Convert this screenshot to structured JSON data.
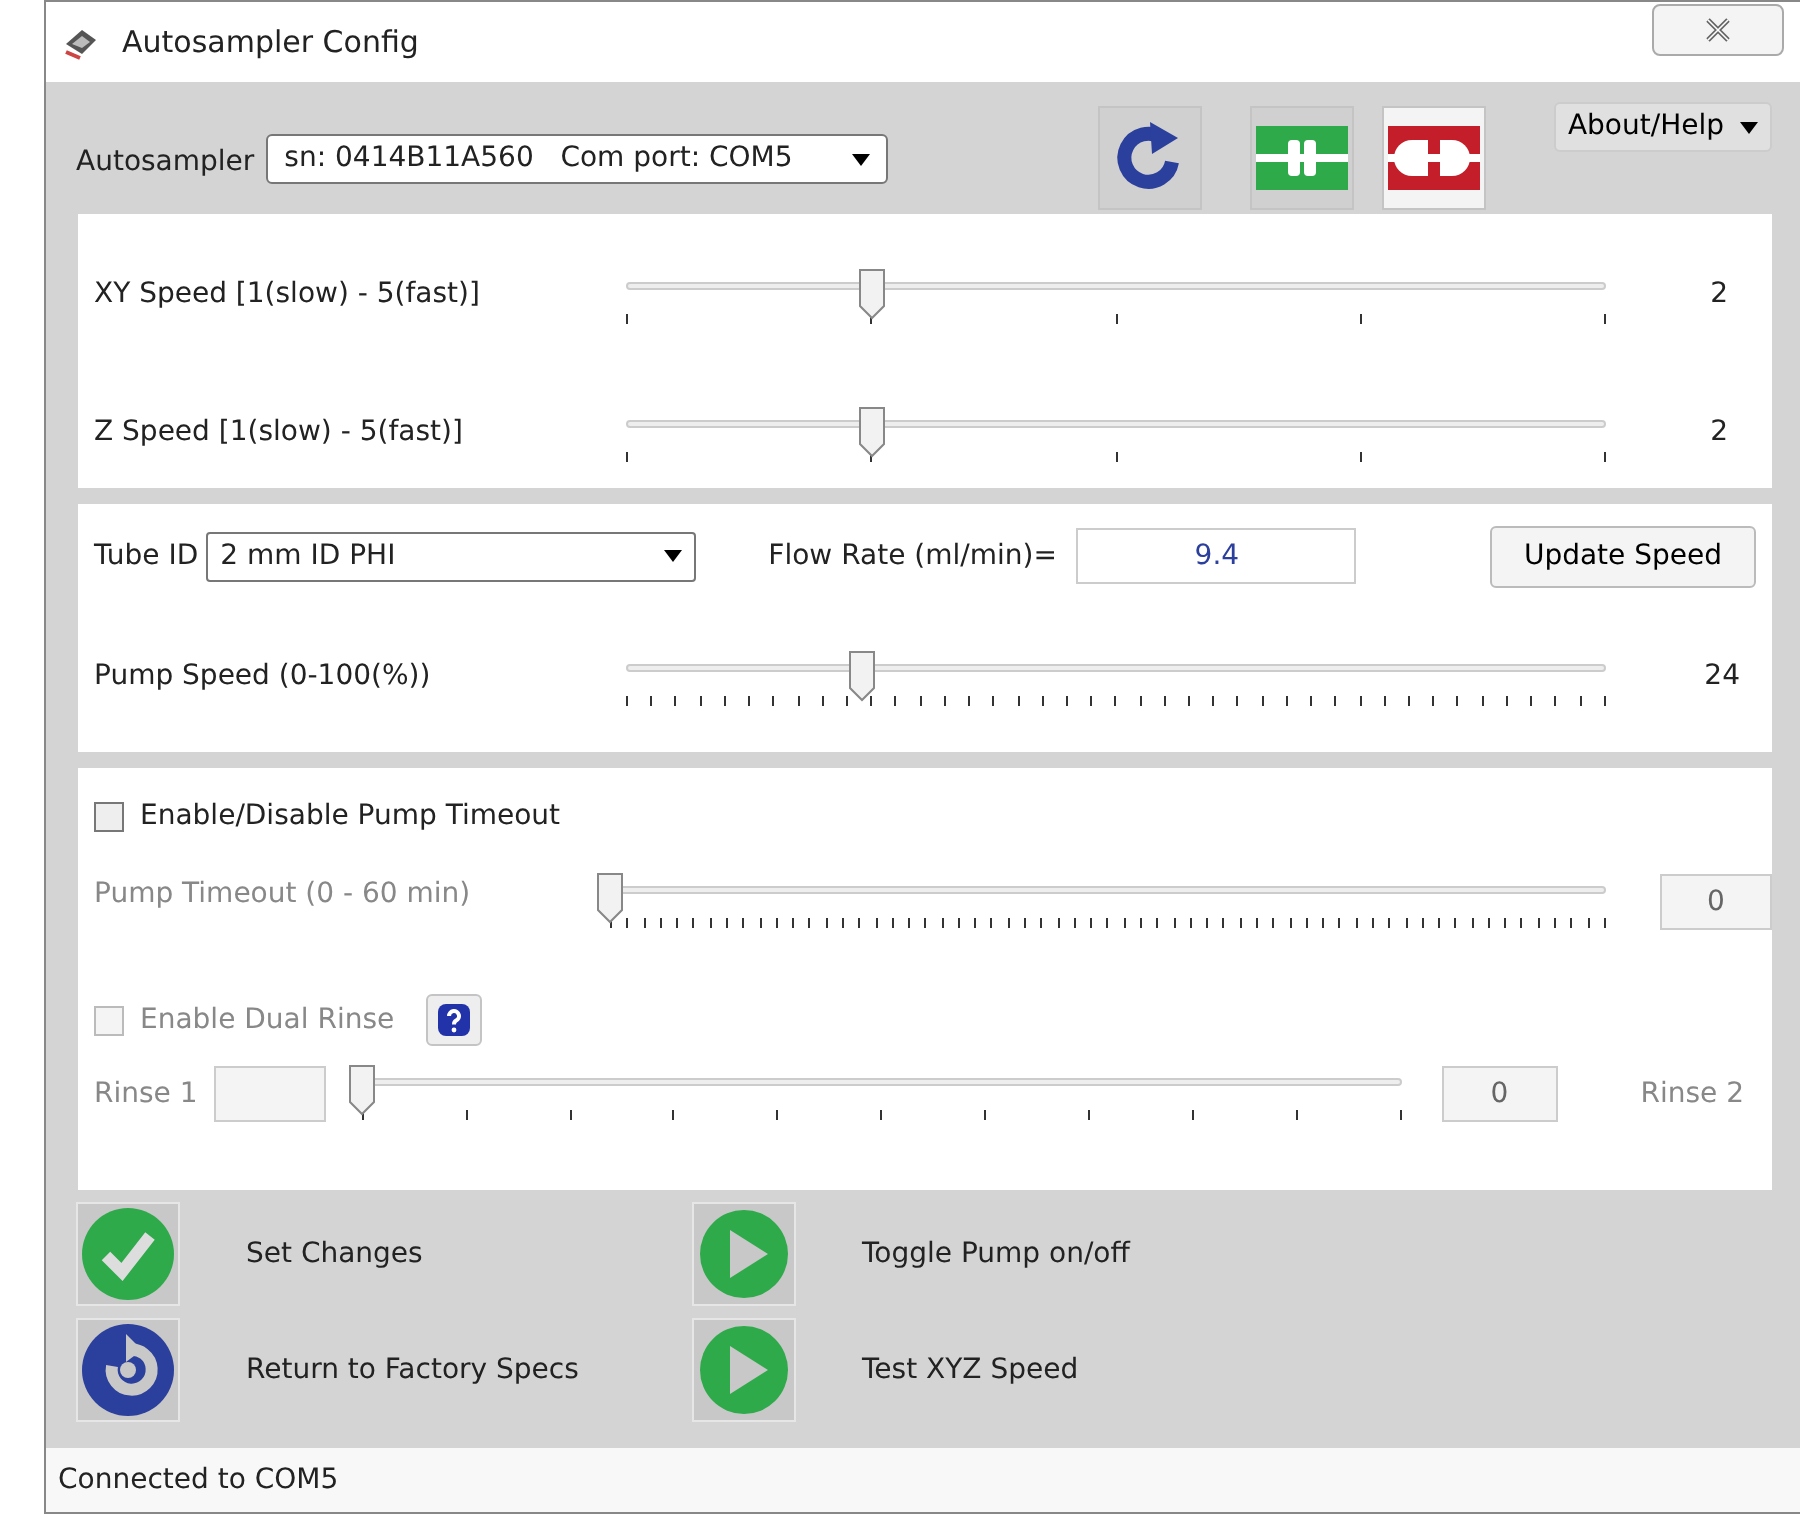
{
  "window": {
    "title": "Autosampler Config"
  },
  "header": {
    "label": "Autosampler",
    "device": "sn: 0414B11A560   Com port: COM5",
    "menu": "About/Help"
  },
  "speed_sliders": [
    {
      "label": "XY Speed [1(slow) - 5(fast)]",
      "level": 0.25,
      "reading": "2"
    },
    {
      "label": "Z Speed [1(slow) - 5(fast)]",
      "level": 0.25,
      "reading": "2"
    }
  ],
  "pump": {
    "tube_label": "Tube ID",
    "tube": "2 mm ID PHI",
    "flow_label": "Flow Rate (ml/min)=",
    "flow": "9.4",
    "update_button": "Update Speed",
    "speed_label": "Pump Speed (0-100(%))",
    "level": 0.24,
    "reading": "24"
  },
  "timeout": {
    "checkbox": "Enable/Disable Pump Timeout",
    "checked": false,
    "label": "Pump Timeout (0 - 60 min)",
    "disabled": true,
    "level": 0,
    "value": "0"
  },
  "rinse": {
    "checkbox": "Enable Dual Rinse",
    "checked": false,
    "disabled": true,
    "rinse1": "Rinse 1",
    "rinse2": "Rinse 2",
    "level": 0,
    "value": "0"
  },
  "actions": [
    {
      "kind": "check",
      "label": "Set Changes"
    },
    {
      "kind": "play",
      "label": "Toggle Pump on/off"
    },
    {
      "kind": "reset",
      "label": "Return to Factory Specs"
    },
    {
      "kind": "play",
      "label": "Test XYZ Speed"
    }
  ],
  "status_bar": "Connected to COM5"
}
